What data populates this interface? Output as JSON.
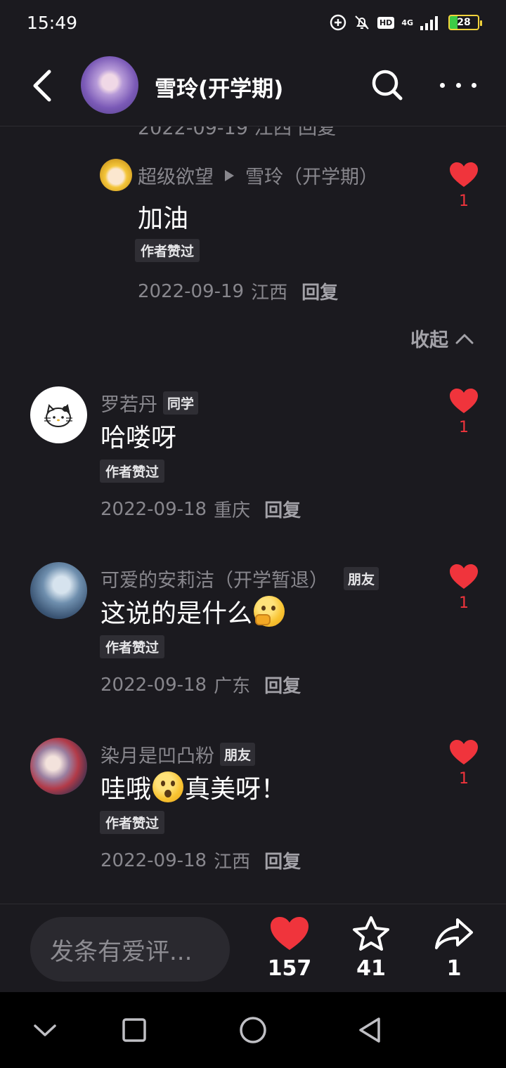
{
  "status_bar": {
    "time": "15:49",
    "hd": "HD",
    "network": "4G",
    "battery": "28",
    "icons": [
      "add-circle-icon",
      "mute-bell-icon",
      "hd-icon",
      "signal-icon",
      "battery-icon"
    ]
  },
  "header": {
    "title": "雪玲(开学期)",
    "back_icon": "chevron-left-icon",
    "search_icon": "search-icon",
    "more_icon": "more-dots-icon"
  },
  "truncated_text": "2022-09-19 江西 回复",
  "reply": {
    "author": "超级欲望",
    "reply_to": "雪玲（开学期）",
    "text": "加油",
    "badge": "作者赞过",
    "date": "2022-09-19",
    "location": "江西",
    "reply_label": "回复",
    "likes": "1"
  },
  "collapse_label": "收起",
  "comments": [
    {
      "name": "罗若丹",
      "relation": "同学",
      "text_before": "哈喽呀",
      "emoji": "",
      "text_after": "",
      "badge": "作者赞过",
      "date": "2022-09-18",
      "location": "重庆",
      "reply_label": "回复",
      "likes": "1"
    },
    {
      "name": "可爱的安莉洁（开学暂退）",
      "relation": "朋友",
      "text_before": "这说的是什么",
      "emoji": "thinking-face-emoji",
      "text_after": "",
      "badge": "作者赞过",
      "date": "2022-09-18",
      "location": "广东",
      "reply_label": "回复",
      "likes": "1"
    },
    {
      "name": "染月是凹凸粉",
      "relation": "朋友",
      "text_before": "哇哦",
      "emoji": "surprised-face-emoji",
      "text_after": "真美呀！",
      "badge": "作者赞过",
      "date": "2022-09-18",
      "location": "江西",
      "reply_label": "回复",
      "likes": "1"
    }
  ],
  "bottom_bar": {
    "input_placeholder": "发条有爱评...",
    "like_count": "157",
    "favorite_count": "41",
    "share_count": "1"
  },
  "colors": {
    "background": "#1b1a1f",
    "accent_red": "#f0343c",
    "muted_text": "#88878d"
  }
}
